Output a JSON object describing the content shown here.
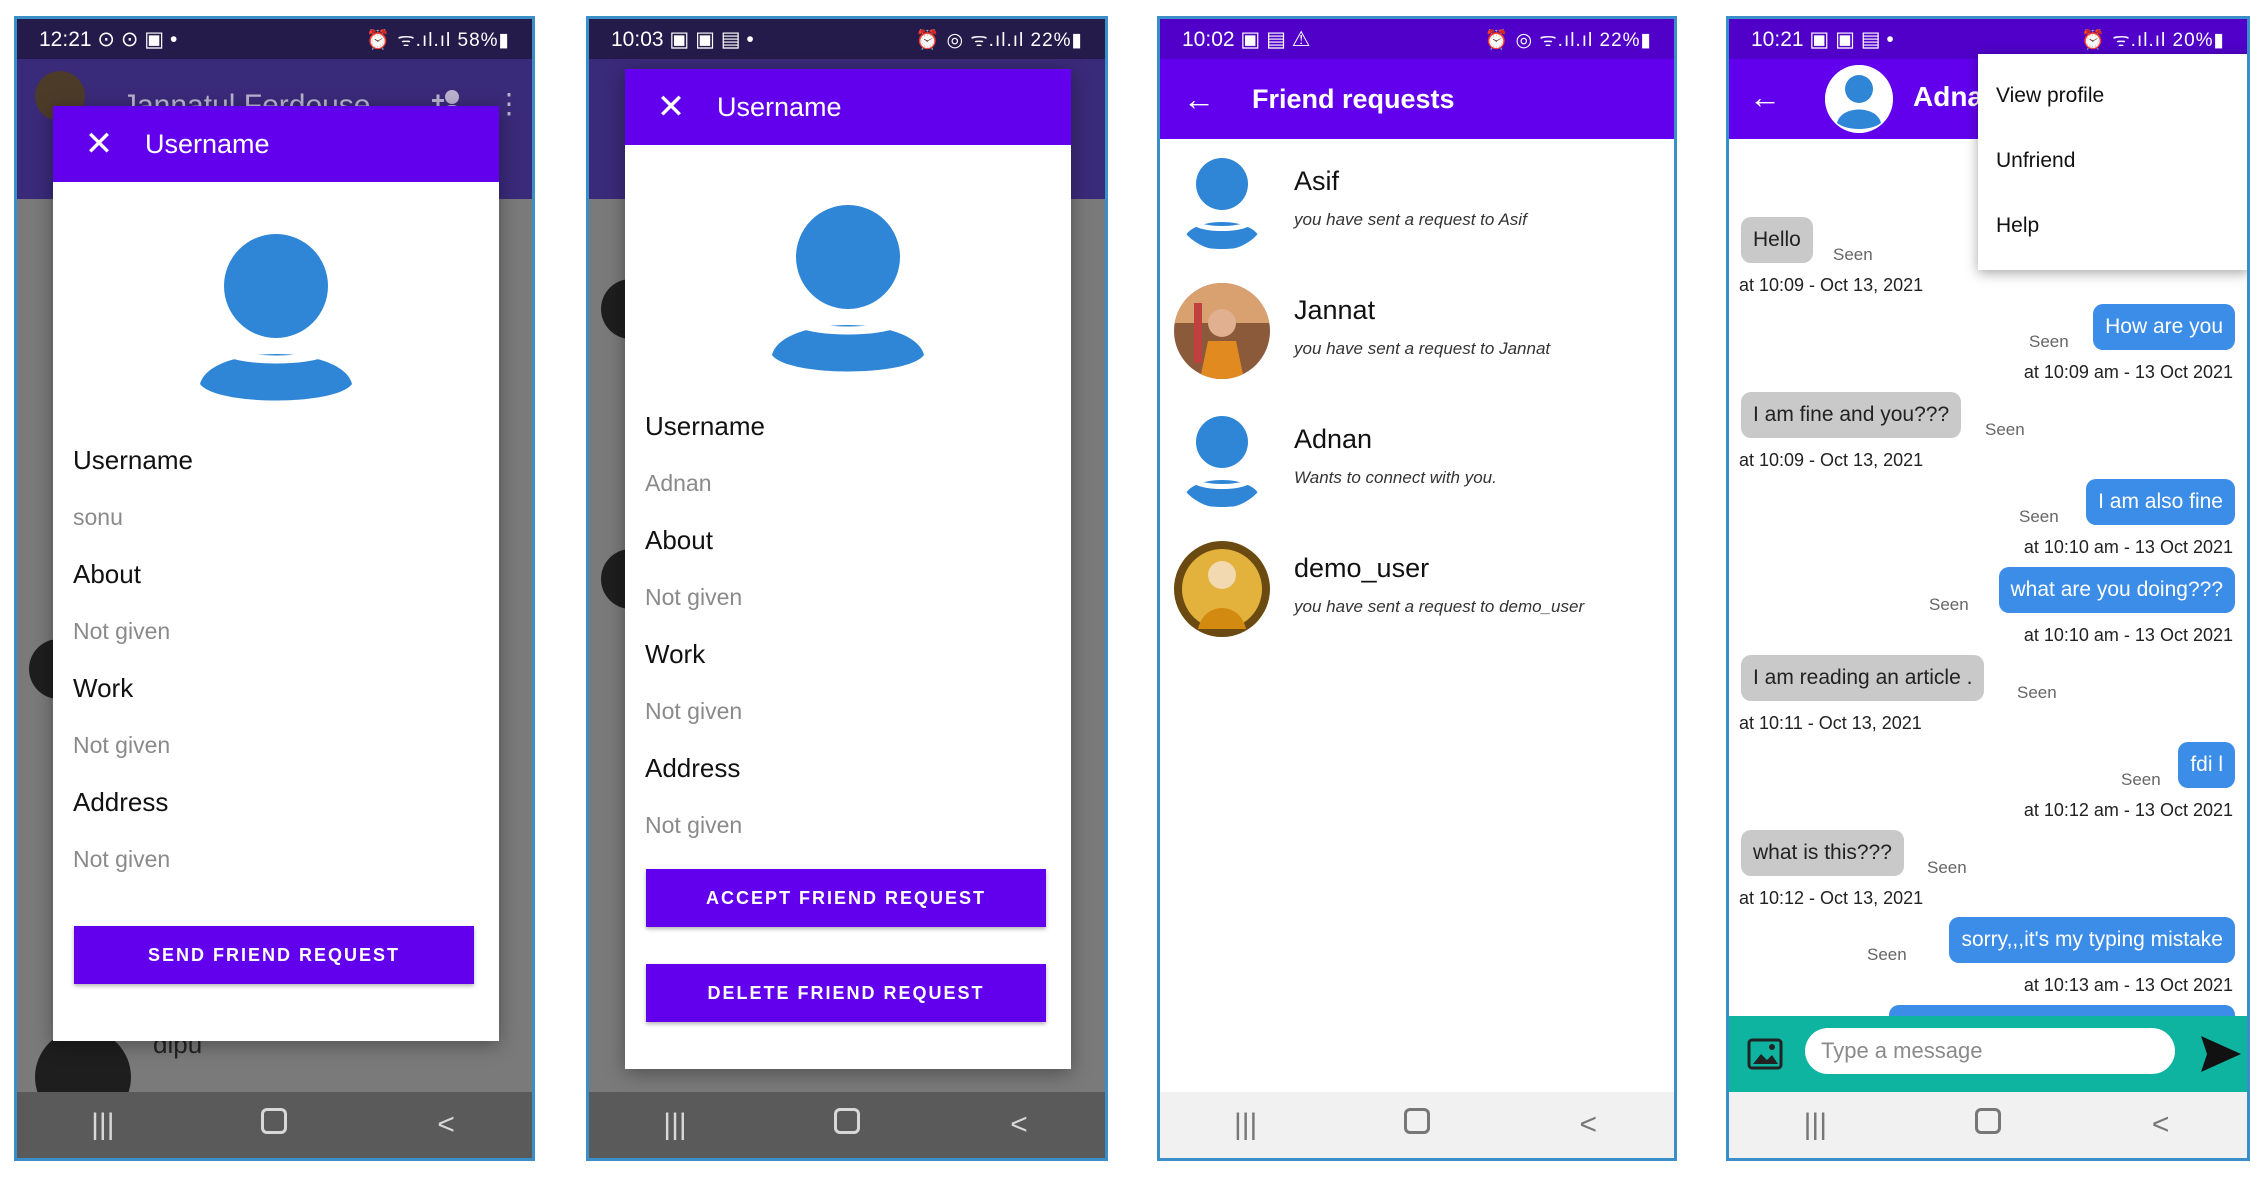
{
  "screen1": {
    "status": {
      "time": "12:21",
      "icons_left": "⊙ ⊙ ▣ •",
      "right": "⏰ ᯤ.ıl.ıl 58%▮"
    },
    "bg_title": "Jannatul Ferdouse",
    "bg_chat_name": "dipu",
    "dialog": {
      "title": "Username",
      "fields": [
        {
          "label": "Username",
          "value": "sonu"
        },
        {
          "label": "About",
          "value": "Not given"
        },
        {
          "label": "Work",
          "value": "Not given"
        },
        {
          "label": "Address",
          "value": "Not given"
        }
      ],
      "button": "SEND FRIEND REQUEST"
    }
  },
  "screen2": {
    "status": {
      "time": "10:03",
      "icons_left": "▣ ▣ ▤ •",
      "right": "⏰ ◎ ᯤ.ıl.ıl 22%▮"
    },
    "dialog": {
      "title": "Username",
      "fields": [
        {
          "label": "Username",
          "value": "Adnan"
        },
        {
          "label": "About",
          "value": "Not given"
        },
        {
          "label": "Work",
          "value": "Not given"
        },
        {
          "label": "Address",
          "value": "Not given"
        }
      ],
      "accept_button": "ACCEPT FRIEND REQUEST",
      "delete_button": "DELETE FRIEND REQUEST"
    }
  },
  "screen3": {
    "status": {
      "time": "10:02",
      "icons_left": "▣ ▤ ⚠",
      "right": "⏰ ◎ ᯤ.ıl.ıl 22%▮"
    },
    "title": "Friend requests",
    "requests": [
      {
        "name": "Asif",
        "subtitle": "you have sent a request to Asif"
      },
      {
        "name": "Jannat",
        "subtitle": "you have sent a request to Jannat"
      },
      {
        "name": "Adnan",
        "subtitle": "Wants to connect with you."
      },
      {
        "name": "demo_user",
        "subtitle": "you have sent a request to demo_user"
      }
    ]
  },
  "screen4": {
    "status": {
      "time": "10:21",
      "icons_left": "▣ ▣ ▤ •",
      "right": "⏰ ᯤ.ıl.ıl 20%▮"
    },
    "chat_name": "Adnan",
    "menu": [
      "View profile",
      "Unfriend",
      "Help"
    ],
    "messages": [
      {
        "text": "Hello",
        "seen": "Seen",
        "time": "at 10:09 - Oct 13, 2021"
      },
      {
        "text": "How are you",
        "seen": "Seen",
        "time": "at 10:09 am - 13 Oct 2021"
      },
      {
        "text": "I am fine and you???",
        "seen": "Seen",
        "time": "at 10:09 - Oct 13, 2021"
      },
      {
        "text": "I am also fine",
        "seen": "Seen",
        "time": "at 10:10 am - 13 Oct 2021"
      },
      {
        "text": "what are you doing???",
        "seen": "Seen",
        "time": "at 10:10 am - 13 Oct 2021"
      },
      {
        "text": "I am reading an article .",
        "seen": "Seen",
        "time": "at 10:11 - Oct 13, 2021"
      },
      {
        "text": "fdi l",
        "seen": "Seen",
        "time": "at 10:12 am - 13 Oct 2021"
      },
      {
        "text": "what is this???",
        "seen": "Seen",
        "time": "at 10:12 - Oct 13, 2021"
      },
      {
        "text": "sorry,,,it's my typing mistake",
        "seen": "Seen",
        "time": "at 10:13 am - 13 Oct 2021"
      }
    ],
    "input_placeholder": "Type a message"
  },
  "nav": {
    "recents": "|||",
    "back": "<"
  },
  "colors": {
    "primary": "#6200ee",
    "outgoing_bubble": "#3b8de8",
    "incoming_bubble": "#c9c9c9",
    "composer": "#0fb4a0",
    "avatar_blue": "#2f86d6"
  }
}
